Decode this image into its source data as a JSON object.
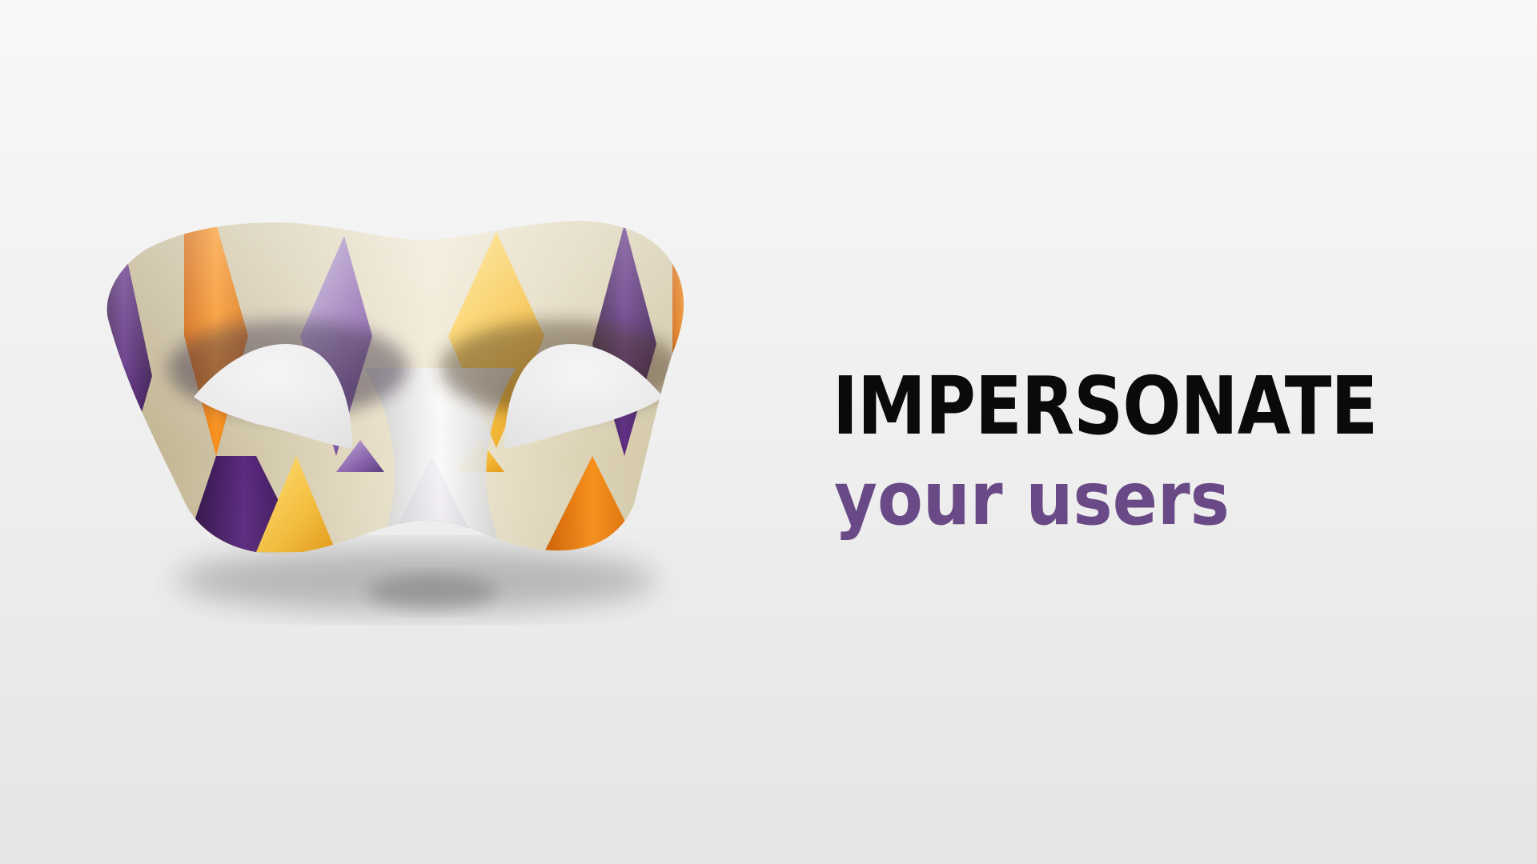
{
  "heading": {
    "title": "IMPERSONATE",
    "subtitle": "your users"
  },
  "colors": {
    "background": "#efefef",
    "title": "#0a0a0a",
    "subtitle": "#6a4a86",
    "mask_purple": "#4a1f66",
    "mask_orange": "#f0820f",
    "mask_yellow": "#f6c23e",
    "mask_lilac": "#9a7ab8",
    "mask_cream": "#e8e0c8"
  },
  "illustration": {
    "icon": "harlequin-mask-icon"
  }
}
